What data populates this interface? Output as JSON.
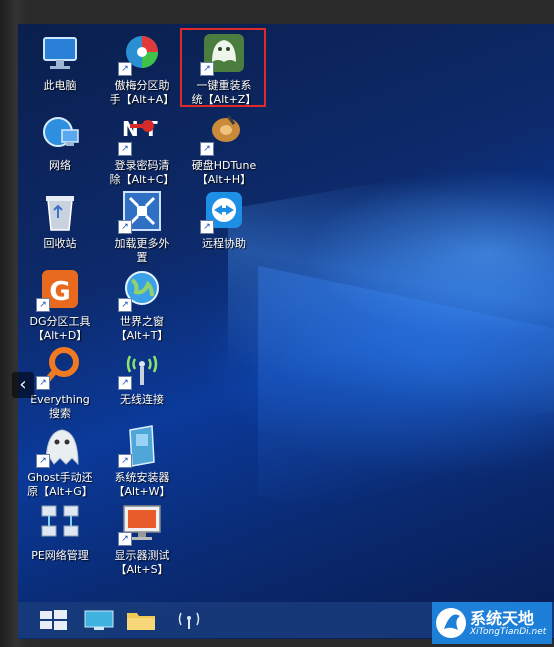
{
  "desktop": {
    "icons": [
      {
        "label": "此电脑"
      },
      {
        "label": "傲梅分区助\n手【Alt+A】"
      },
      {
        "label": "一键重装系\n统【Alt+Z】"
      },
      {
        "label": "网络"
      },
      {
        "label": "登录密码清\n除【Alt+C】"
      },
      {
        "label": "硬盘HDTune\n【Alt+H】"
      },
      {
        "label": "回收站"
      },
      {
        "label": "加载更多外\n置"
      },
      {
        "label": "远程协助"
      },
      {
        "label": "DG分区工具\n【Alt+D】"
      },
      {
        "label": "世界之窗\n【Alt+T】"
      },
      {
        "label": "Everything\n搜索"
      },
      {
        "label": "无线连接"
      },
      {
        "label": "Ghost手动还\n原【Alt+G】"
      },
      {
        "label": "系统安装器\n【Alt+W】"
      },
      {
        "label": "PE网络管理"
      },
      {
        "label": "显示器测试\n【Alt+S】"
      }
    ]
  },
  "taskbar": {
    "buttons": [
      {
        "icon": "windows-start-icon"
      },
      {
        "icon": "desktop-icon"
      },
      {
        "icon": "folder-icon"
      },
      {
        "icon": "wireless-icon"
      }
    ]
  },
  "watermark": {
    "title": "系统天地",
    "subtitle": "XiTongTianDi.net"
  },
  "colors": {
    "highlight": "#e02a2a",
    "taskbar": "#193c7d",
    "watermark": "#1d7fd8"
  }
}
